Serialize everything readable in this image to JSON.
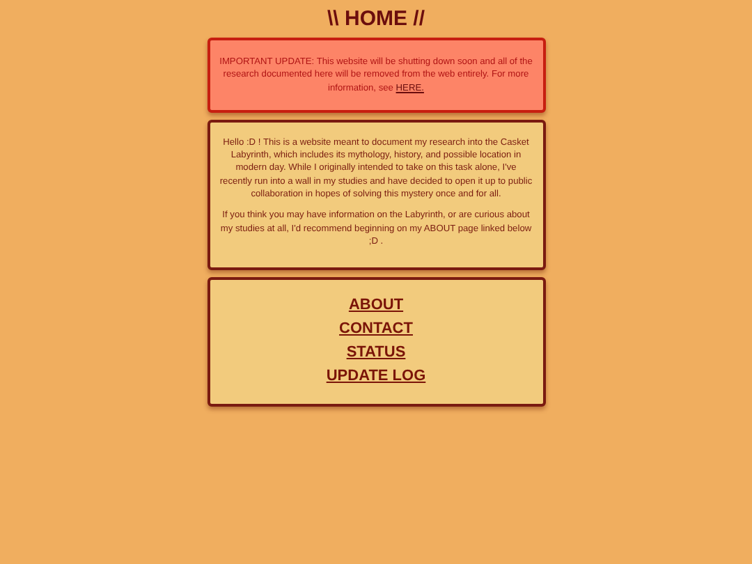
{
  "title": "\\\\ HOME //",
  "alert": {
    "text": "IMPORTANT UPDATE: This website will be shutting down soon and all of the research documented here will be removed from the web entirely. For more information, see ",
    "link": "HERE."
  },
  "intro": {
    "paragraphs": [
      "Hello :D ! This is a website meant to document my research into the Casket Labyrinth, which includes its mythology, history, and possible location in modern day. While I originally intended to take on this task alone, I've recently run into a wall in my studies and have decided to open it up to public collaboration in hopes of solving this mystery once and for all.",
      "If you think you may have information on the Labyrinth, or are curious about my studies at all, I'd recommend beginning on my ABOUT page linked below ;D ."
    ]
  },
  "nav": [
    "ABOUT",
    "CONTACT",
    "STATUS",
    "UPDATE LOG"
  ]
}
